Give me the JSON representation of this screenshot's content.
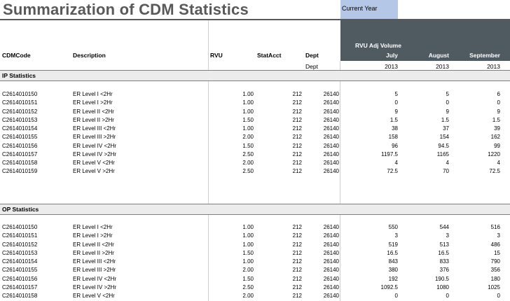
{
  "title": "Summarization of CDM Statistics",
  "current_year_label": "Current Year",
  "header": {
    "cdmcode": "CDMCode",
    "description": "Description",
    "rvu": "RVU",
    "statacct": "StatAcct",
    "dept": "Dept",
    "dept_sub": "Dept",
    "rvu_adj_volume": "RVU Adj Volume",
    "months": [
      "July",
      "August",
      "September"
    ],
    "years": [
      "2013",
      "2013",
      "2013"
    ]
  },
  "sections": [
    {
      "name": "IP Statistics",
      "rows": [
        {
          "code": "C2614010150",
          "desc": "ER Level I <2Hr",
          "rvu": "1.00",
          "stat": "212",
          "dept": "26140",
          "jul": "5",
          "aug": "5",
          "sep": "6"
        },
        {
          "code": "C2614010151",
          "desc": "ER Level I >2Hr",
          "rvu": "1.00",
          "stat": "212",
          "dept": "26140",
          "jul": "0",
          "aug": "0",
          "sep": "0"
        },
        {
          "code": "C2614010152",
          "desc": "ER Level II <2Hr",
          "rvu": "1.00",
          "stat": "212",
          "dept": "26140",
          "jul": "9",
          "aug": "9",
          "sep": "9"
        },
        {
          "code": "C2614010153",
          "desc": "ER Level II >2Hr",
          "rvu": "1.50",
          "stat": "212",
          "dept": "26140",
          "jul": "1.5",
          "aug": "1.5",
          "sep": "1.5"
        },
        {
          "code": "C2614010154",
          "desc": "ER Level III <2Hr",
          "rvu": "1.00",
          "stat": "212",
          "dept": "26140",
          "jul": "38",
          "aug": "37",
          "sep": "39"
        },
        {
          "code": "C2614010155",
          "desc": "ER Level III >2Hr",
          "rvu": "2.00",
          "stat": "212",
          "dept": "26140",
          "jul": "158",
          "aug": "154",
          "sep": "162"
        },
        {
          "code": "C2614010156",
          "desc": "ER Level IV <2Hr",
          "rvu": "1.50",
          "stat": "212",
          "dept": "26140",
          "jul": "96",
          "aug": "94.5",
          "sep": "99"
        },
        {
          "code": "C2614010157",
          "desc": "ER Level IV >2Hr",
          "rvu": "2.50",
          "stat": "212",
          "dept": "26140",
          "jul": "1197.5",
          "aug": "1165",
          "sep": "1220"
        },
        {
          "code": "C2614010158",
          "desc": "ER Level V <2Hr",
          "rvu": "2.00",
          "stat": "212",
          "dept": "26140",
          "jul": "4",
          "aug": "4",
          "sep": "4"
        },
        {
          "code": "C2614010159",
          "desc": "ER Level V >2Hr",
          "rvu": "2.50",
          "stat": "212",
          "dept": "26140",
          "jul": "72.5",
          "aug": "70",
          "sep": "72.5"
        }
      ]
    },
    {
      "name": "OP Statistics",
      "rows": [
        {
          "code": "C2614010150",
          "desc": "ER Level I <2Hr",
          "rvu": "1.00",
          "stat": "212",
          "dept": "26140",
          "jul": "550",
          "aug": "544",
          "sep": "516"
        },
        {
          "code": "C2614010151",
          "desc": "ER Level I >2Hr",
          "rvu": "1.00",
          "stat": "212",
          "dept": "26140",
          "jul": "3",
          "aug": "3",
          "sep": "3"
        },
        {
          "code": "C2614010152",
          "desc": "ER Level II <2Hr",
          "rvu": "1.00",
          "stat": "212",
          "dept": "26140",
          "jul": "519",
          "aug": "513",
          "sep": "486"
        },
        {
          "code": "C2614010153",
          "desc": "ER Level II >2Hr",
          "rvu": "1.50",
          "stat": "212",
          "dept": "26140",
          "jul": "16.5",
          "aug": "16.5",
          "sep": "15"
        },
        {
          "code": "C2614010154",
          "desc": "ER Level III <2Hr",
          "rvu": "1.00",
          "stat": "212",
          "dept": "26140",
          "jul": "843",
          "aug": "833",
          "sep": "790"
        },
        {
          "code": "C2614010155",
          "desc": "ER Level III >2Hr",
          "rvu": "2.00",
          "stat": "212",
          "dept": "26140",
          "jul": "380",
          "aug": "376",
          "sep": "356"
        },
        {
          "code": "C2614010156",
          "desc": "ER Level IV <2Hr",
          "rvu": "1.50",
          "stat": "212",
          "dept": "26140",
          "jul": "192",
          "aug": "190.5",
          "sep": "180"
        },
        {
          "code": "C2614010157",
          "desc": "ER Level IV >2Hr",
          "rvu": "2.50",
          "stat": "212",
          "dept": "26140",
          "jul": "1092.5",
          "aug": "1080",
          "sep": "1025"
        },
        {
          "code": "C2614010158",
          "desc": "ER Level V <2Hr",
          "rvu": "2.00",
          "stat": "212",
          "dept": "26140",
          "jul": "0",
          "aug": "0",
          "sep": "0"
        }
      ]
    }
  ]
}
